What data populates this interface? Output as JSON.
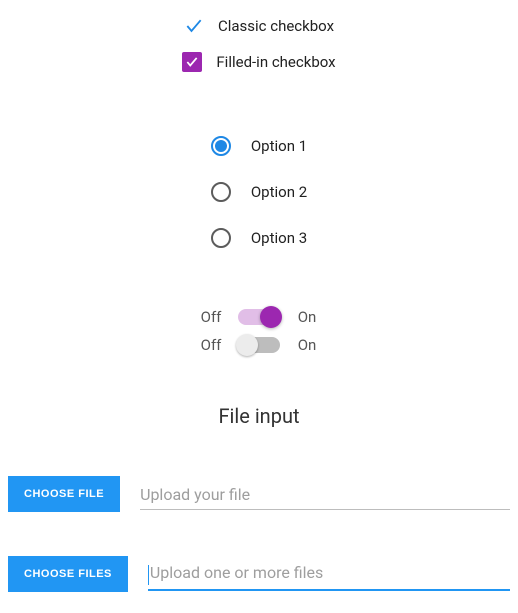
{
  "checkboxes": {
    "classic": {
      "label": "Classic checkbox",
      "checked": true
    },
    "filled": {
      "label": "Filled-in checkbox",
      "checked": true
    }
  },
  "radios": {
    "items": [
      {
        "label": "Option 1",
        "selected": true
      },
      {
        "label": "Option 2",
        "selected": false
      },
      {
        "label": "Option 3",
        "selected": false
      }
    ]
  },
  "switches": {
    "off_label": "Off",
    "on_label": "On",
    "items": [
      {
        "state": "on",
        "color": "purple"
      },
      {
        "state": "off",
        "color": "grey"
      }
    ]
  },
  "file_section": {
    "title": "File input",
    "single": {
      "button": "CHOOSE FILE",
      "placeholder": "Upload your file",
      "focused": false
    },
    "multi": {
      "button": "CHOOSE FILES",
      "placeholder": "Upload one or more files",
      "focused": true
    }
  },
  "colors": {
    "primary_blue": "#2196f3",
    "purple": "#9c27b0"
  }
}
